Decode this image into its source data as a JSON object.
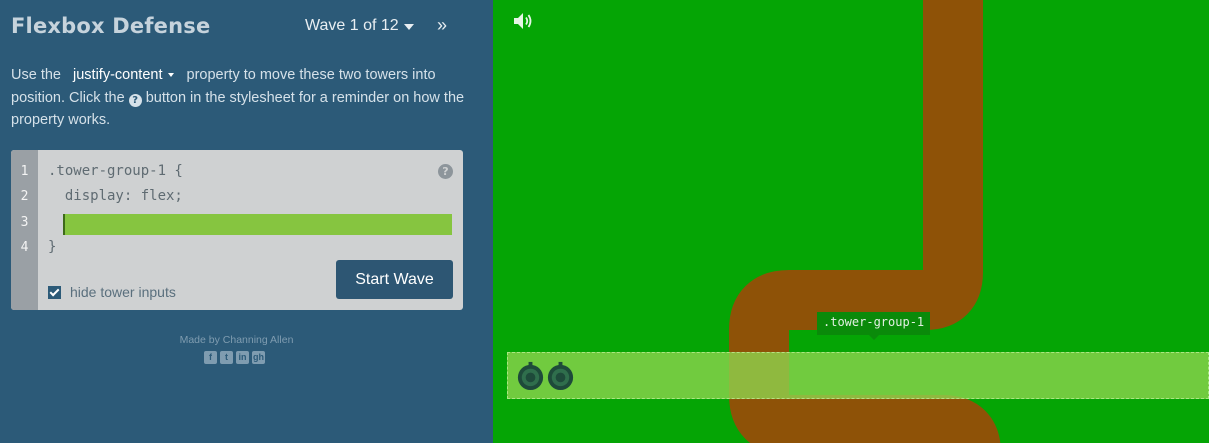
{
  "app": {
    "title": "Flexbox Defense",
    "wave_label": "Wave 1 of 12",
    "next_wave_glyph": "»"
  },
  "instructions": {
    "before": "Use the",
    "property": "justify-content",
    "middle": "property to move these two towers into position. Click the",
    "help_glyph": "?",
    "after": "button in the stylesheet for a reminder on how the property works."
  },
  "editor": {
    "line_numbers": [
      "1",
      "2",
      "3",
      "4"
    ],
    "line1": ".tower-group-1 {",
    "line2": "  display: flex;",
    "input_value": "",
    "line4": "}",
    "help_glyph": "?",
    "start_wave_label": "Start Wave",
    "hide_inputs_label": "hide tower inputs",
    "hide_inputs_checked": true
  },
  "footer": {
    "credit": "Made by Channing Allen",
    "social_icons": [
      "facebook-icon",
      "twitter-icon",
      "linkedin-icon",
      "github-icon"
    ],
    "social_glyphs": [
      "f",
      "t",
      "in",
      "gh"
    ]
  },
  "board": {
    "group_label": ".tower-group-1",
    "towers": [
      "tower",
      "tower"
    ],
    "colors": {
      "sidebar": "#2c5a78",
      "grass": "#05a505",
      "path": "#8e5207",
      "tower_group": "#8fd650",
      "code_input": "#86c540",
      "button": "#2d5673"
    }
  }
}
